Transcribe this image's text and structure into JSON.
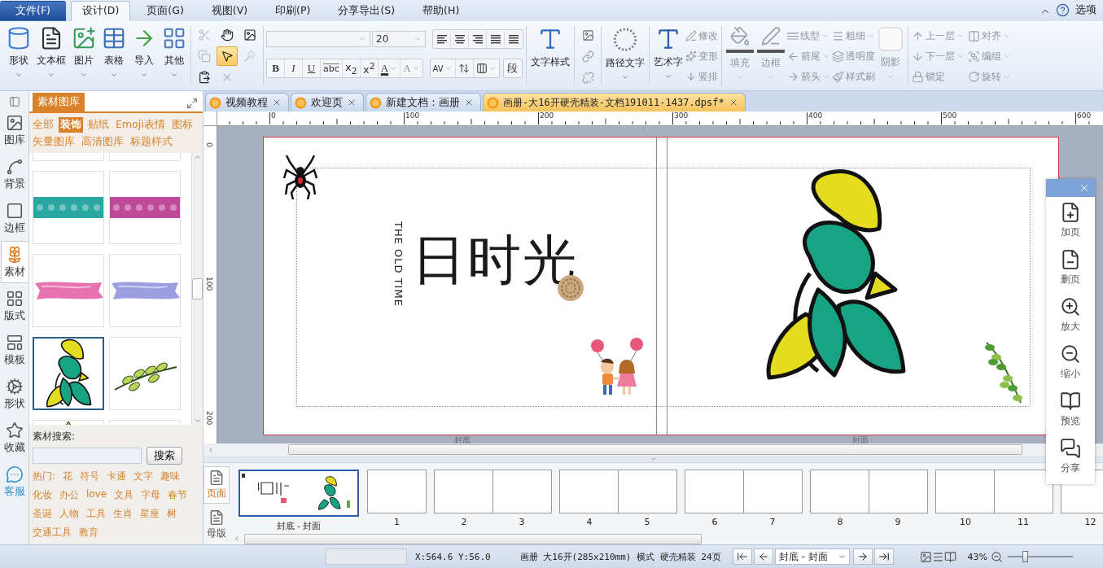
{
  "menu": [
    {
      "label": "文件(F)",
      "kind": "file",
      "selected": false
    },
    {
      "label": "设计(D)",
      "kind": "tab",
      "selected": true
    },
    {
      "label": "页面(G)",
      "kind": "tab",
      "selected": false
    },
    {
      "label": "视图(V)",
      "kind": "tab",
      "selected": false
    },
    {
      "label": "印刷(P)",
      "kind": "tab",
      "selected": false
    },
    {
      "label": "分享导出(S)",
      "kind": "tab",
      "selected": false
    },
    {
      "label": "帮助(H)",
      "kind": "tab",
      "selected": false
    }
  ],
  "options_label": "选项",
  "insert_tools": [
    {
      "kind": "shape",
      "label": "形状"
    },
    {
      "kind": "textbox",
      "label": "文本框"
    },
    {
      "kind": "image",
      "label": "图片"
    },
    {
      "kind": "table",
      "label": "表格"
    },
    {
      "kind": "import",
      "label": "导入"
    },
    {
      "kind": "other",
      "label": "其他"
    }
  ],
  "edit_tools": [
    {
      "kind": "cut",
      "selected": false,
      "disabled": true
    },
    {
      "kind": "hand",
      "selected": false,
      "disabled": false
    },
    {
      "kind": "picture-edit",
      "selected": false,
      "disabled": false
    },
    {
      "kind": "copy",
      "selected": false,
      "disabled": true
    },
    {
      "kind": "pointer",
      "selected": true,
      "disabled": false
    },
    {
      "kind": "magic",
      "selected": false,
      "disabled": true
    },
    {
      "kind": "paste",
      "selected": false,
      "disabled": false
    },
    {
      "kind": "delete",
      "selected": false,
      "disabled": true
    }
  ],
  "font": {
    "size": "20",
    "style_buttons": [
      {
        "kind": "bold",
        "label": "B"
      },
      {
        "kind": "italic",
        "label": "I"
      },
      {
        "kind": "underline",
        "label": "U"
      },
      {
        "kind": "strike",
        "label": "abc"
      },
      {
        "kind": "sub",
        "label": "x$_{2}$"
      },
      {
        "kind": "sup",
        "label": "x$^{2}$"
      },
      {
        "kind": "color",
        "label": "A"
      },
      {
        "kind": "shade",
        "label": "A"
      }
    ],
    "spacing_label": "AV",
    "paragraph_label": "段"
  },
  "text_tools": {
    "text_style": "文字样式",
    "path_text": "路径文字",
    "art_text": "艺术字",
    "art_options": [
      {
        "kind": "edit",
        "label": "修改"
      },
      {
        "kind": "warp",
        "label": "变形"
      },
      {
        "kind": "vertical",
        "label": "竖排"
      }
    ]
  },
  "shape_tools": {
    "disabled": true,
    "fill": "填充",
    "border": "边框",
    "line_options": [
      {
        "kind": "line-type",
        "label": "线型"
      },
      {
        "kind": "arrow-tail",
        "label": "箭尾"
      },
      {
        "kind": "arrow-head",
        "label": "箭头"
      }
    ],
    "weight_options": [
      {
        "kind": "weight",
        "label": "粗细"
      },
      {
        "kind": "opacity",
        "label": "透明度"
      },
      {
        "kind": "brush",
        "label": "样式刷"
      }
    ],
    "shadow": "阴影"
  },
  "arrange_tools": {
    "disabled": true,
    "items": [
      {
        "kind": "up",
        "label": "上一层"
      },
      {
        "kind": "align",
        "label": "对齐"
      },
      {
        "kind": "down",
        "label": "下一层"
      },
      {
        "kind": "group",
        "label": "编组"
      },
      {
        "kind": "lock",
        "label": "锁定"
      },
      {
        "kind": "rotate",
        "label": "旋转"
      }
    ]
  },
  "left_rail": [
    {
      "kind": "gallery",
      "label": "图库",
      "selected": false
    },
    {
      "kind": "background",
      "label": "背景",
      "selected": false
    },
    {
      "kind": "border",
      "label": "边框",
      "selected": false
    },
    {
      "kind": "material",
      "label": "素材",
      "selected": true
    },
    {
      "kind": "layout",
      "label": "版式",
      "selected": false
    },
    {
      "kind": "template",
      "label": "模板",
      "selected": false
    },
    {
      "kind": "shape",
      "label": "形状",
      "selected": false
    },
    {
      "kind": "favorite",
      "label": "收藏",
      "selected": false
    },
    {
      "kind": "service",
      "label": "客服",
      "selected": false
    }
  ],
  "gallery": {
    "title": "素材图库",
    "categories": [
      {
        "label": "全部",
        "selected": false
      },
      {
        "label": "装饰",
        "selected": true
      },
      {
        "label": "贴纸",
        "selected": false
      },
      {
        "label": "Emoji表情",
        "selected": false
      },
      {
        "label": "图标",
        "selected": false
      },
      {
        "label": "矢量图库",
        "selected": false
      },
      {
        "label": "高清图库",
        "selected": false
      },
      {
        "label": "标题样式",
        "selected": false
      }
    ],
    "items": [
      {
        "kind": "blank",
        "selected": false
      },
      {
        "kind": "blank",
        "selected": false
      },
      {
        "kind": "tape",
        "color": "#2aa7a0",
        "selected": false
      },
      {
        "kind": "tape",
        "color": "#c04a9a",
        "selected": false
      },
      {
        "kind": "brush",
        "color": "#e772b0",
        "selected": false
      },
      {
        "kind": "brush",
        "color": "#9c9ee0",
        "selected": false
      },
      {
        "kind": "plant",
        "selected": true
      },
      {
        "kind": "branch",
        "selected": false
      },
      {
        "kind": "sprout",
        "selected": false
      },
      {
        "kind": "blank",
        "selected": false
      }
    ],
    "search_label": "素材搜索:",
    "search_button": "搜索",
    "hot_label": "热门:",
    "hot_tags": [
      "花",
      "符号",
      "卡通",
      "文字",
      "趣味",
      "化妆",
      "办公",
      "love",
      "文具",
      "字母",
      "春节",
      "圣诞",
      "人物",
      "工具",
      "生肖",
      "星座",
      "树",
      "交通工具",
      "教育"
    ]
  },
  "doc_tabs": [
    {
      "label": "视频教程",
      "selected": false
    },
    {
      "label": "欢迎页",
      "selected": false
    },
    {
      "label": "新建文档：画册",
      "selected": false
    },
    {
      "label": "画册-大16开硬壳精装-文档191011-1437.dpsf*",
      "selected": true
    }
  ],
  "ruler": {
    "x_labels": [
      "0",
      "100",
      "200",
      "300",
      "400",
      "500",
      "600"
    ],
    "y_labels": [
      "0",
      "100",
      "200"
    ]
  },
  "page": {
    "subtitle": "THE OLD TIME",
    "title": "日时光",
    "spread_labels": [
      "封底",
      "封面"
    ]
  },
  "side_panel": [
    {
      "kind": "add-page",
      "label": "加页"
    },
    {
      "kind": "delete-page",
      "label": "删页"
    },
    {
      "kind": "zoom-in",
      "label": "放大"
    },
    {
      "kind": "zoom-out",
      "label": "缩小"
    },
    {
      "kind": "preview",
      "label": "预览"
    },
    {
      "kind": "share",
      "label": "分享"
    }
  ],
  "page_strip": {
    "tabs": [
      {
        "label": "页面",
        "selected": true
      },
      {
        "label": "母版",
        "selected": false
      }
    ],
    "pages": [
      {
        "kind": "cover",
        "labels": [
          "封底 - 封面"
        ],
        "selected": true
      },
      {
        "kind": "single",
        "labels": [
          "1"
        ],
        "selected": false
      },
      {
        "kind": "spread",
        "labels": [
          "2",
          "3"
        ],
        "selected": false
      },
      {
        "kind": "spread",
        "labels": [
          "4",
          "5"
        ],
        "selected": false
      },
      {
        "kind": "spread",
        "labels": [
          "6",
          "7"
        ],
        "selected": false
      },
      {
        "kind": "spread",
        "labels": [
          "8",
          "9"
        ],
        "selected": false
      },
      {
        "kind": "spread",
        "labels": [
          "10",
          "11"
        ],
        "selected": false
      },
      {
        "kind": "single",
        "labels": [
          "12"
        ],
        "selected": false
      }
    ]
  },
  "status": {
    "coords": "X:564.6  Y:56.0",
    "info": "画册 大16开(285x210mm) 横式 硬壳精装 24页",
    "current_page": "封底 - 封面",
    "zoom": "43%",
    "zoom_slider": {
      "level": 0.22
    }
  }
}
